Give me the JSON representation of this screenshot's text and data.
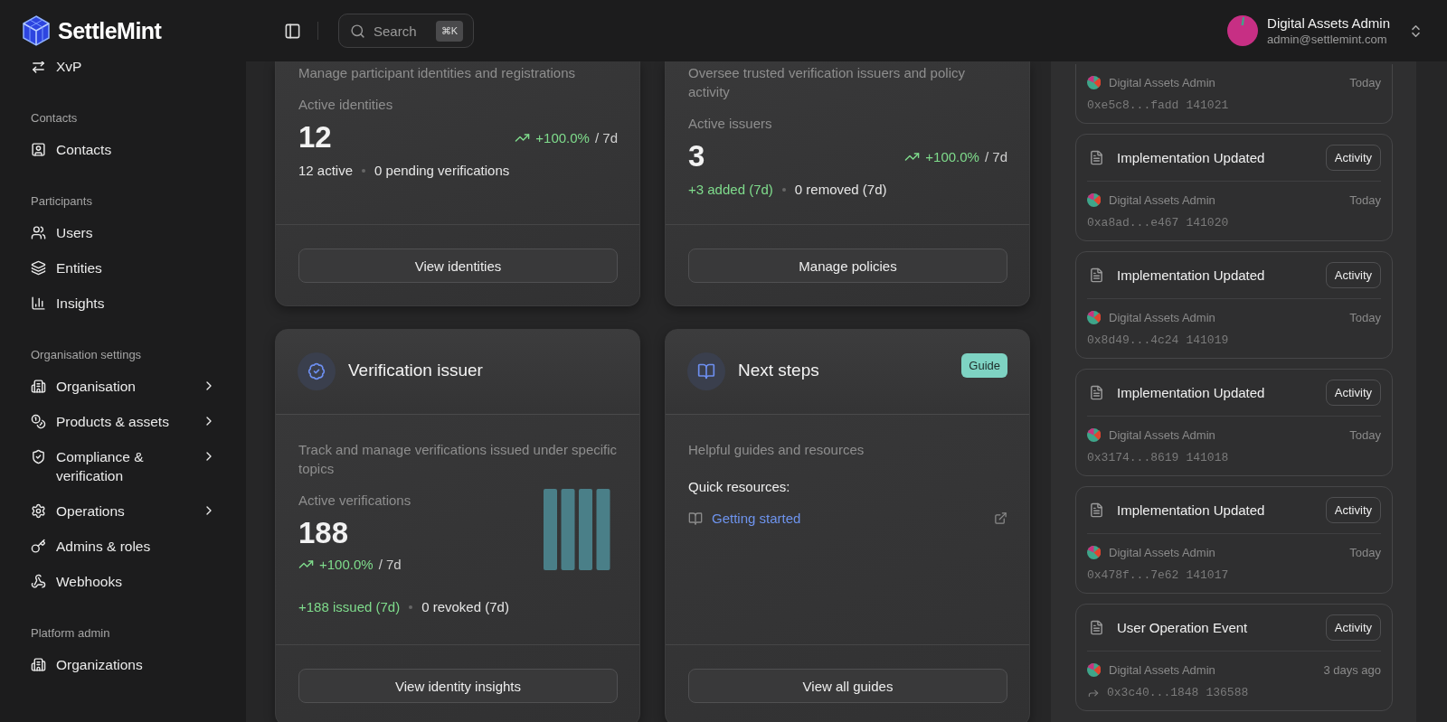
{
  "header": {
    "logo": "SettleMint",
    "search": {
      "placeholder": "Search",
      "shortcut": "⌘K"
    },
    "user": {
      "name": "Digital Assets Admin",
      "email": "admin@settlemint.com"
    }
  },
  "sidebar": {
    "sections": [
      {
        "items": [
          {
            "label": "XvP",
            "expandable": false
          }
        ]
      },
      {
        "heading": "Contacts",
        "items": [
          {
            "label": "Contacts",
            "expandable": false
          }
        ]
      },
      {
        "heading": "Participants",
        "items": [
          {
            "label": "Users",
            "expandable": false
          },
          {
            "label": "Entities",
            "expandable": false
          },
          {
            "label": "Insights",
            "expandable": false
          }
        ]
      },
      {
        "heading": "Organisation settings",
        "items": [
          {
            "label": "Organisation",
            "expandable": true
          },
          {
            "label": "Products & assets",
            "expandable": true
          },
          {
            "label": "Compliance & verification",
            "expandable": true
          },
          {
            "label": "Operations",
            "expandable": true
          },
          {
            "label": "Admins & roles",
            "expandable": false
          },
          {
            "label": "Webhooks",
            "expandable": false
          }
        ]
      },
      {
        "heading": "Platform admin",
        "items": [
          {
            "label": "Organizations",
            "expandable": false
          }
        ]
      }
    ]
  },
  "cards": [
    {
      "kind": "metric",
      "description": "Manage participant identities and registrations",
      "metric_label": "Active identities",
      "value": "12",
      "trend": "+100.0%",
      "period": "/ 7d",
      "stats": [
        {
          "text": "12 active",
          "positive": false
        },
        {
          "text": "0 pending verifications",
          "positive": false
        }
      ],
      "button": "View identities"
    },
    {
      "kind": "metric",
      "description": "Oversee trusted verification issuers and policy activity",
      "metric_label": "Active issuers",
      "value": "3",
      "trend": "+100.0%",
      "period": "/ 7d",
      "stats": [
        {
          "text": "+3 added (7d)",
          "positive": true
        },
        {
          "text": "0 removed (7d)",
          "positive": false
        }
      ],
      "button": "Manage policies"
    },
    {
      "kind": "metric",
      "title": "Verification issuer",
      "description": "Track and manage verifications issued under specific topics",
      "metric_label": "Active verifications",
      "value": "188",
      "trend": "+100.0%",
      "period": "/ 7d",
      "chart": {
        "kind": "picture"
      },
      "stats": [
        {
          "text": "+188 issued (7d)",
          "positive": true
        },
        {
          "text": "0 revoked (7d)",
          "positive": false
        }
      ],
      "button": "View identity insights"
    },
    {
      "kind": "guide",
      "title": "Next steps",
      "badge": "Guide",
      "description": "Helpful guides and resources",
      "resources_heading": "Quick resources:",
      "links": [
        "Getting started"
      ],
      "button": "View all guides"
    }
  ],
  "activity": [
    {
      "user": "Digital Assets Admin",
      "time": "Today",
      "hash": "0xe5c8...fadd",
      "block": "141021",
      "forwarded": false
    },
    {
      "title": "Implementation Updated",
      "badge": "Activity",
      "user": "Digital Assets Admin",
      "time": "Today",
      "hash": "0xa8ad...e467",
      "block": "141020",
      "forwarded": false
    },
    {
      "title": "Implementation Updated",
      "badge": "Activity",
      "user": "Digital Assets Admin",
      "time": "Today",
      "hash": "0x8d49...4c24",
      "block": "141019",
      "forwarded": false
    },
    {
      "title": "Implementation Updated",
      "badge": "Activity",
      "user": "Digital Assets Admin",
      "time": "Today",
      "hash": "0x3174...8619",
      "block": "141018",
      "forwarded": false
    },
    {
      "title": "Implementation Updated",
      "badge": "Activity",
      "user": "Digital Assets Admin",
      "time": "Today",
      "hash": "0x478f...7e62",
      "block": "141017",
      "forwarded": false
    },
    {
      "title": "User Operation Event",
      "badge": "Activity",
      "user": "Digital Assets Admin",
      "time": "3 days ago",
      "hash": "0x3c40...1848",
      "block": "136588",
      "forwarded": true
    }
  ]
}
